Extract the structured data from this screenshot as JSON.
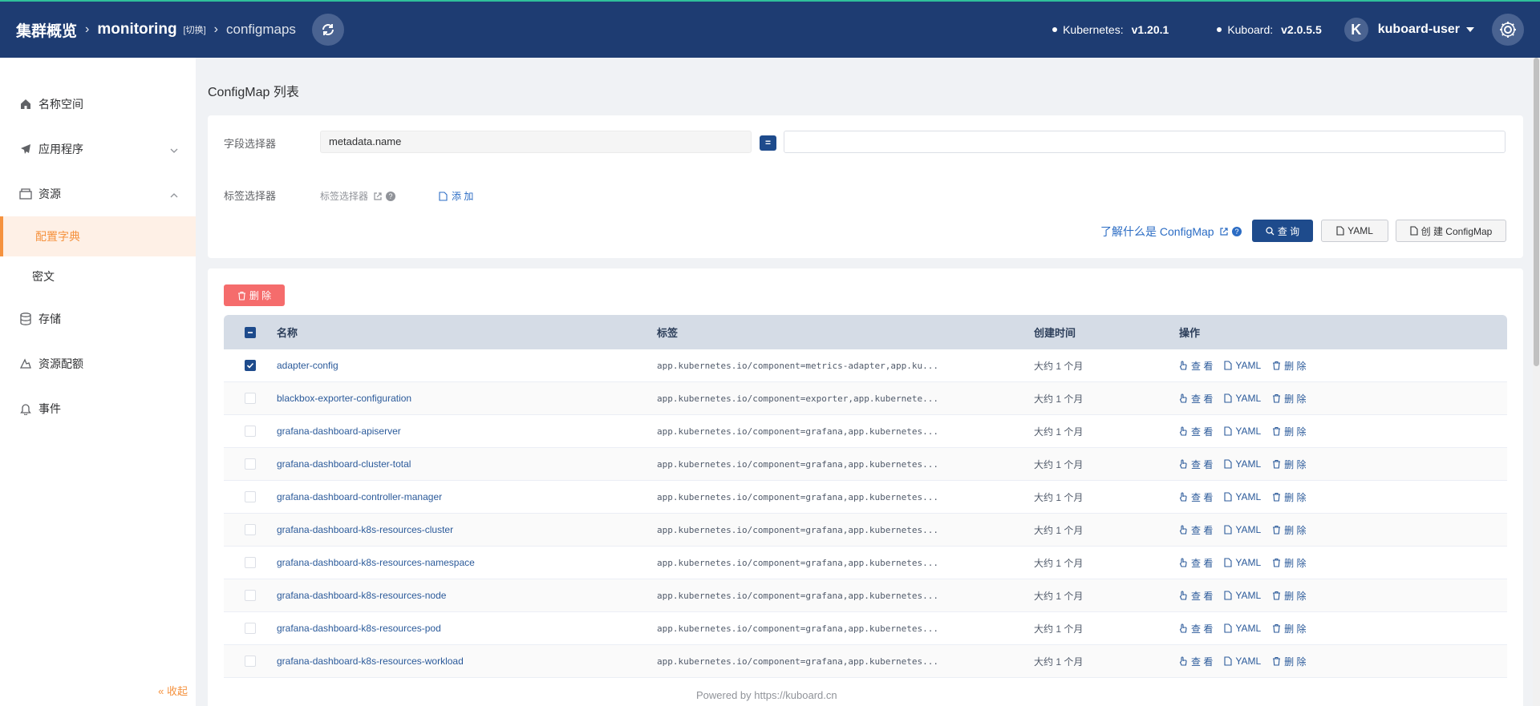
{
  "header": {
    "cluster_overview": "集群概览",
    "namespace": "monitoring",
    "switch_label": "[切换]",
    "page": "configmaps",
    "k8s_label": "Kubernetes:",
    "k8s_version": "v1.20.1",
    "kuboard_label": "Kuboard:",
    "kuboard_version": "v2.0.5.5",
    "avatar_letter": "K",
    "username": "kuboard-user"
  },
  "sidebar": {
    "items": [
      {
        "label": "名称空间",
        "icon": "home-icon"
      },
      {
        "label": "应用程序",
        "icon": "send-icon"
      },
      {
        "label": "资源",
        "icon": "box-icon"
      },
      {
        "label": "存储",
        "icon": "database-icon"
      },
      {
        "label": "资源配额",
        "icon": "cloud-icon"
      },
      {
        "label": "事件",
        "icon": "bell-icon"
      }
    ],
    "sub_items": [
      "配置字典",
      "密文"
    ],
    "collapse": "收起"
  },
  "main": {
    "title": "ConfigMap 列表",
    "field_selector_label": "字段选择器",
    "field_selector_value": "metadata.name",
    "eq_symbol": "=",
    "label_selector_label": "标签选择器",
    "label_selector_link": "标签选择器",
    "add_label": "添 加",
    "help_text": "了解什么是 ConfigMap",
    "query_btn": "查 询",
    "yaml_btn": "YAML",
    "create_btn": "创 建 ConfigMap",
    "delete_btn": "删 除"
  },
  "table": {
    "headers": [
      "名称",
      "标签",
      "创建时间",
      "操作"
    ],
    "ops": [
      "查 看",
      "YAML",
      "删 除"
    ],
    "rows": [
      {
        "name": "adapter-config",
        "labels": "app.kubernetes.io/component=metrics-adapter,app.ku...",
        "created": "大约 1 个月",
        "checked": true
      },
      {
        "name": "blackbox-exporter-configuration",
        "labels": "app.kubernetes.io/component=exporter,app.kubernete...",
        "created": "大约 1 个月",
        "checked": false
      },
      {
        "name": "grafana-dashboard-apiserver",
        "labels": "app.kubernetes.io/component=grafana,app.kubernetes...",
        "created": "大约 1 个月",
        "checked": false
      },
      {
        "name": "grafana-dashboard-cluster-total",
        "labels": "app.kubernetes.io/component=grafana,app.kubernetes...",
        "created": "大约 1 个月",
        "checked": false
      },
      {
        "name": "grafana-dashboard-controller-manager",
        "labels": "app.kubernetes.io/component=grafana,app.kubernetes...",
        "created": "大约 1 个月",
        "checked": false
      },
      {
        "name": "grafana-dashboard-k8s-resources-cluster",
        "labels": "app.kubernetes.io/component=grafana,app.kubernetes...",
        "created": "大约 1 个月",
        "checked": false
      },
      {
        "name": "grafana-dashboard-k8s-resources-namespace",
        "labels": "app.kubernetes.io/component=grafana,app.kubernetes...",
        "created": "大约 1 个月",
        "checked": false
      },
      {
        "name": "grafana-dashboard-k8s-resources-node",
        "labels": "app.kubernetes.io/component=grafana,app.kubernetes...",
        "created": "大约 1 个月",
        "checked": false
      },
      {
        "name": "grafana-dashboard-k8s-resources-pod",
        "labels": "app.kubernetes.io/component=grafana,app.kubernetes...",
        "created": "大约 1 个月",
        "checked": false
      },
      {
        "name": "grafana-dashboard-k8s-resources-workload",
        "labels": "app.kubernetes.io/component=grafana,app.kubernetes...",
        "created": "大约 1 个月",
        "checked": false
      }
    ]
  },
  "footer": {
    "powered_by": "Powered by",
    "url": "https://kuboard.cn"
  },
  "colors": {
    "header_bg": "#1e3c72",
    "accent_orange": "#f5923e",
    "primary_blue": "#1e4b8c",
    "danger_red": "#f56c6c"
  }
}
